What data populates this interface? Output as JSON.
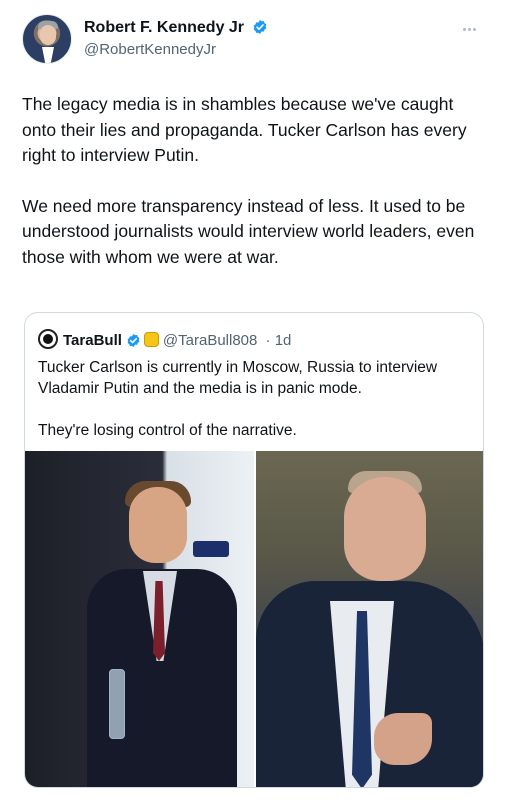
{
  "author": {
    "display_name": "Robert F. Kennedy Jr",
    "handle": "@RobertKennedyJr"
  },
  "tweet": {
    "paragraphs": [
      "The legacy media is in shambles because we've caught onto their lies and propaganda. Tucker Carlson has every right to interview Putin.",
      "We need more transparency instead of less. It used to be understood journalists would interview world leaders, even those with whom we were at war."
    ]
  },
  "quoted": {
    "display_name": "TaraBull",
    "handle": "@TaraBull808",
    "time": "· 1d",
    "paragraphs": [
      "Tucker Carlson is currently in Moscow, Russia to interview Vladamir Putin and the media is in panic mode.",
      "They're losing control of the narrative."
    ]
  },
  "colors": {
    "verified_blue": "#1d9bf0",
    "secondary_text": "#536471",
    "border": "#cfd9de"
  }
}
